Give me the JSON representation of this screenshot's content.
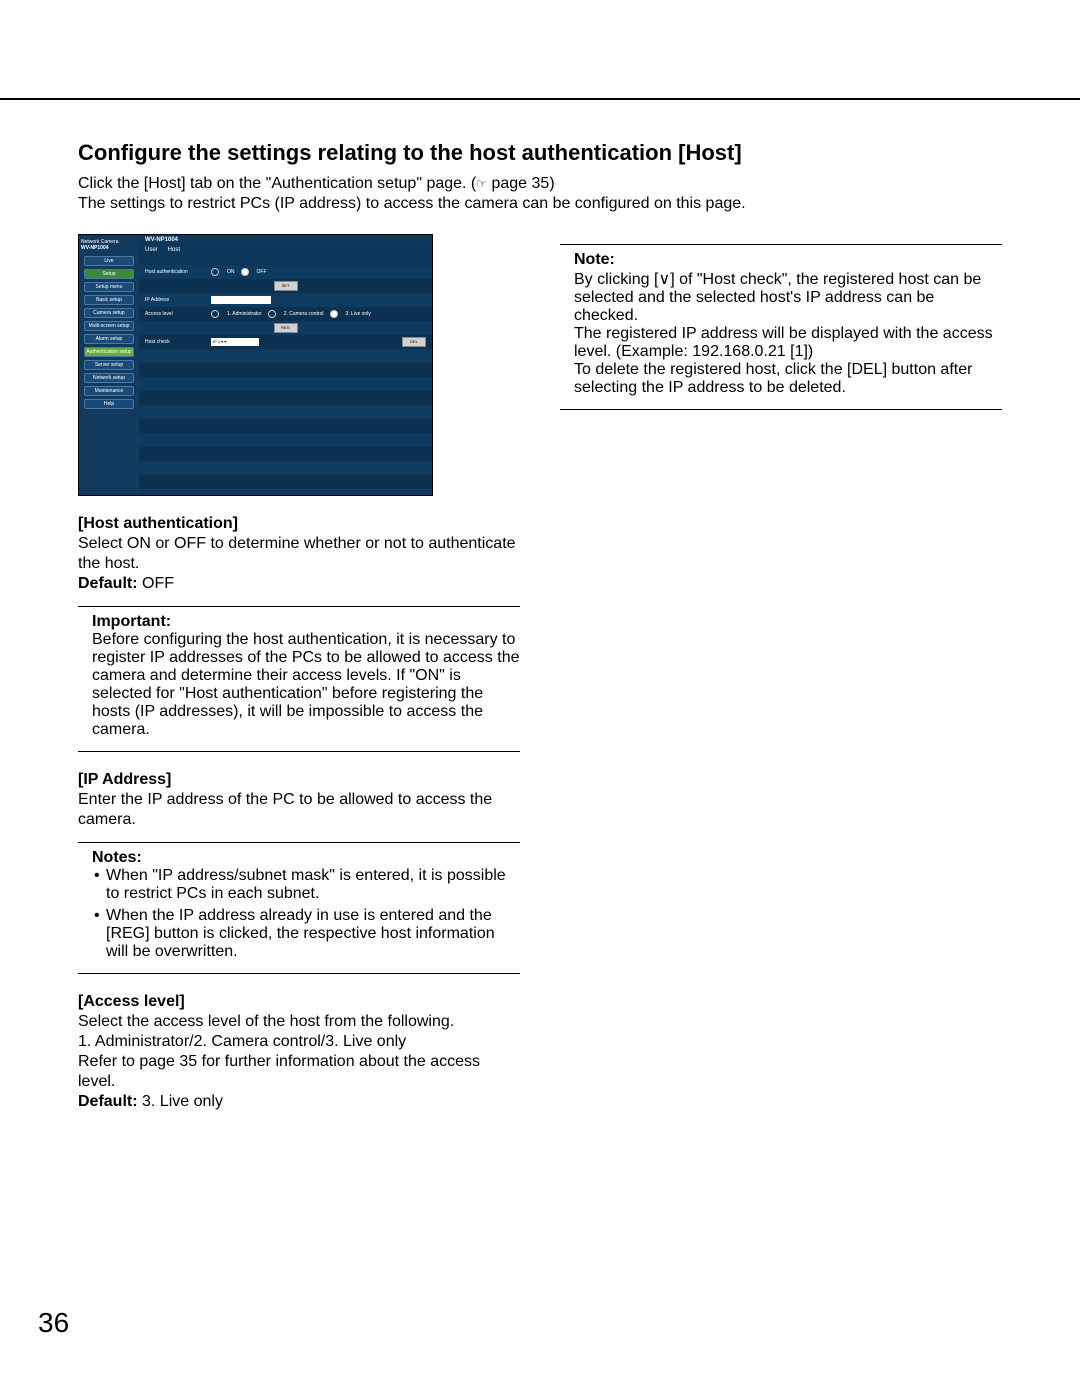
{
  "title": "Configure the settings relating to the host authentication [Host]",
  "intro": {
    "line1a": "Click the [Host] tab on the \"Authentication setup\" page.",
    "line1b": "page 35",
    "line2": "The settings to restrict PCs (IP address) to access the camera can be configured on this page."
  },
  "labels": {
    "default": "Default:"
  },
  "hostauth": {
    "head": "[Host authentication]",
    "body": "Select ON or OFF to determine whether or not to authenticate the host.",
    "default": "OFF"
  },
  "important": {
    "head": "Important:",
    "body": "Before configuring the host authentication, it is necessary to register IP addresses of the PCs to be allowed to access the camera and determine their access levels. If \"ON\" is selected for \"Host authentication\" before registering the hosts (IP addresses), it will be impossible to access the camera."
  },
  "ip": {
    "head": "[IP Address]",
    "body": "Enter the IP address of the PC to be allowed to access the camera."
  },
  "notes": {
    "head": "Notes:",
    "items": [
      "When \"IP address/subnet mask\" is entered, it is possible to restrict PCs in each subnet.",
      "When the IP address already in use is entered and the [REG] button is clicked, the respective host information will be overwritten."
    ]
  },
  "access": {
    "head": "[Access level]",
    "body1": "Select the access level of the host from the following.",
    "body2": "1. Administrator/2. Camera control/3. Live only",
    "body3": "Refer to page 35 for further information about the access level.",
    "default": "3. Live only"
  },
  "rightnote": {
    "head": "Note:",
    "l1a": "By clicking",
    "l1b": "of \"Host check\", the registered host can be selected and the selected host's IP address can be checked.",
    "l2": "The registered IP address will be displayed with the access level. (Example: 192.168.0.21 [1])",
    "l3": "To delete the registered host, click the [DEL] button after selecting the IP address to be deleted."
  },
  "ss": {
    "brand1": "Network Camera",
    "brand2": "WV-NP1004",
    "title": "WV-NP1004",
    "nav": [
      "Live",
      "Setup",
      "Setup menu",
      "Basic setup",
      "Camera setup",
      "Multi-screen setup",
      "Alarm setup",
      "Authentication setup",
      "Server setup",
      "Network setup",
      "Maintenance",
      "Help"
    ],
    "tabs": [
      "User",
      "Host"
    ],
    "rows": {
      "hostauth": "Host authentication",
      "on": "ON",
      "off": "OFF",
      "set": "SET",
      "ip": "IP Address",
      "access": "Access level",
      "lvl1": "1. Administrator",
      "lvl2": "2. Camera control",
      "lvl3": "3. Live only",
      "reg": "REG",
      "hostcheck": "Host check",
      "selectval": "IP 1 ▾",
      "del": "DEL"
    }
  },
  "page": "36"
}
